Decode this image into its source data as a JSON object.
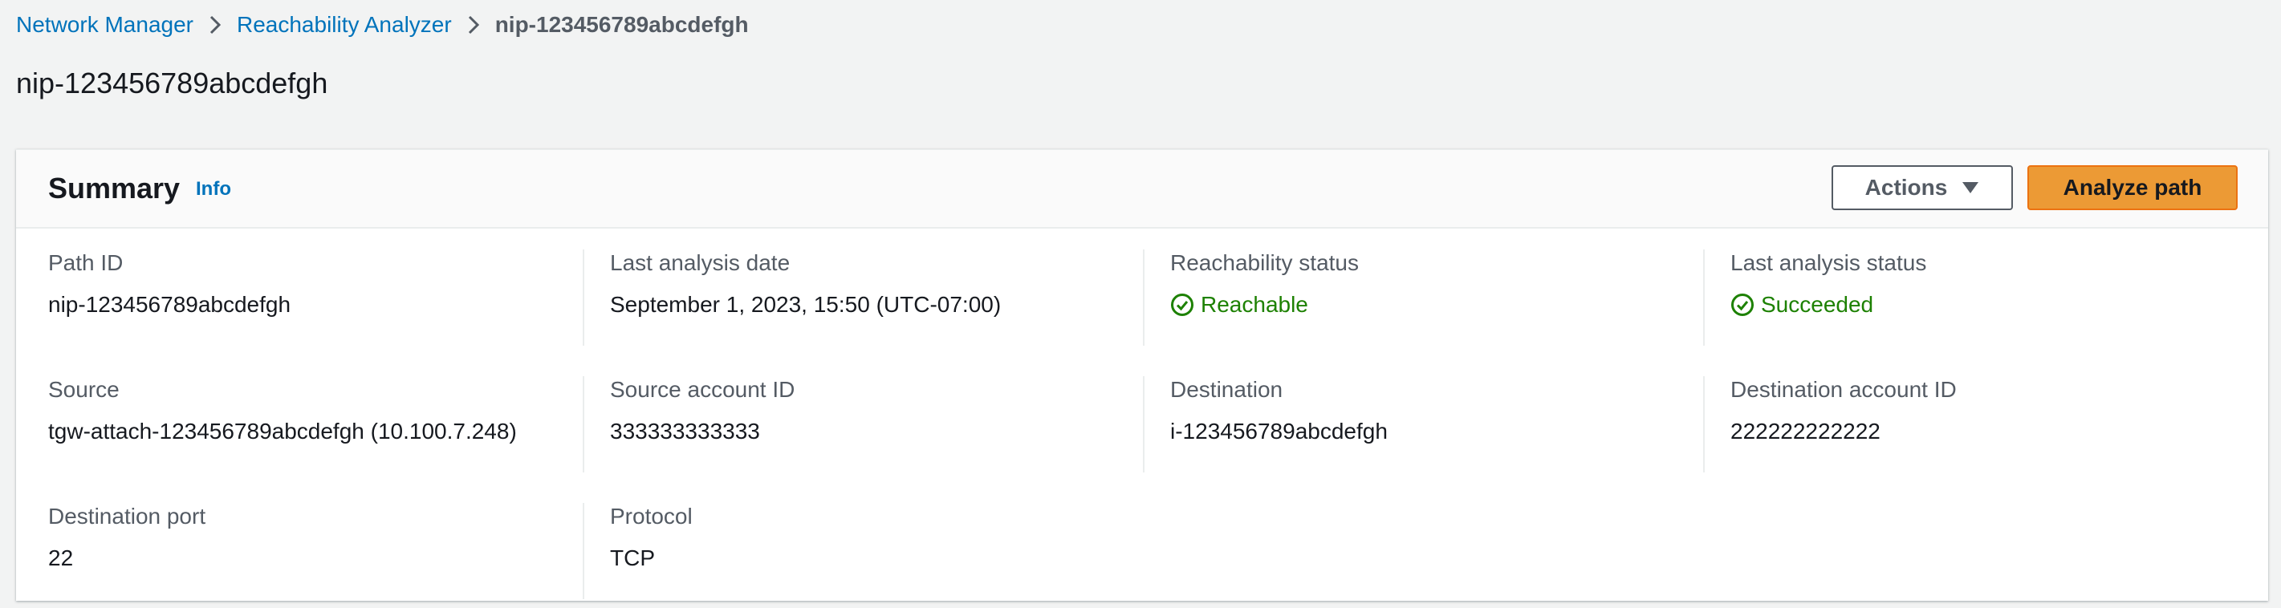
{
  "breadcrumb": {
    "items": [
      {
        "label": "Network Manager"
      },
      {
        "label": "Reachability Analyzer"
      },
      {
        "label": "nip-123456789abcdefgh"
      }
    ]
  },
  "page_title": "nip-123456789abcdefgh",
  "summary": {
    "title": "Summary",
    "info_label": "Info",
    "actions_label": "Actions",
    "primary_label": "Analyze path",
    "fields": {
      "path_id": {
        "label": "Path ID",
        "value": "nip-123456789abcdefgh"
      },
      "last_analysis_date": {
        "label": "Last analysis date",
        "value": "September 1, 2023, 15:50 (UTC-07:00)"
      },
      "reachability_status": {
        "label": "Reachability status",
        "value": "Reachable",
        "icon": "check-circle-icon"
      },
      "last_analysis_status": {
        "label": "Last analysis status",
        "value": "Succeeded",
        "icon": "check-circle-icon"
      },
      "source": {
        "label": "Source",
        "value": "tgw-attach-123456789abcdefgh (10.100.7.248)"
      },
      "source_account_id": {
        "label": "Source account ID",
        "value": "333333333333"
      },
      "destination": {
        "label": "Destination",
        "value": "i-123456789abcdefgh"
      },
      "destination_account_id": {
        "label": "Destination account ID",
        "value": "222222222222"
      },
      "destination_port": {
        "label": "Destination port",
        "value": "22"
      },
      "protocol": {
        "label": "Protocol",
        "value": "TCP"
      }
    }
  },
  "colors": {
    "link": "#0073bb",
    "success": "#1d8102",
    "primary_button": "#ec9a35",
    "background": "#f2f3f3"
  }
}
